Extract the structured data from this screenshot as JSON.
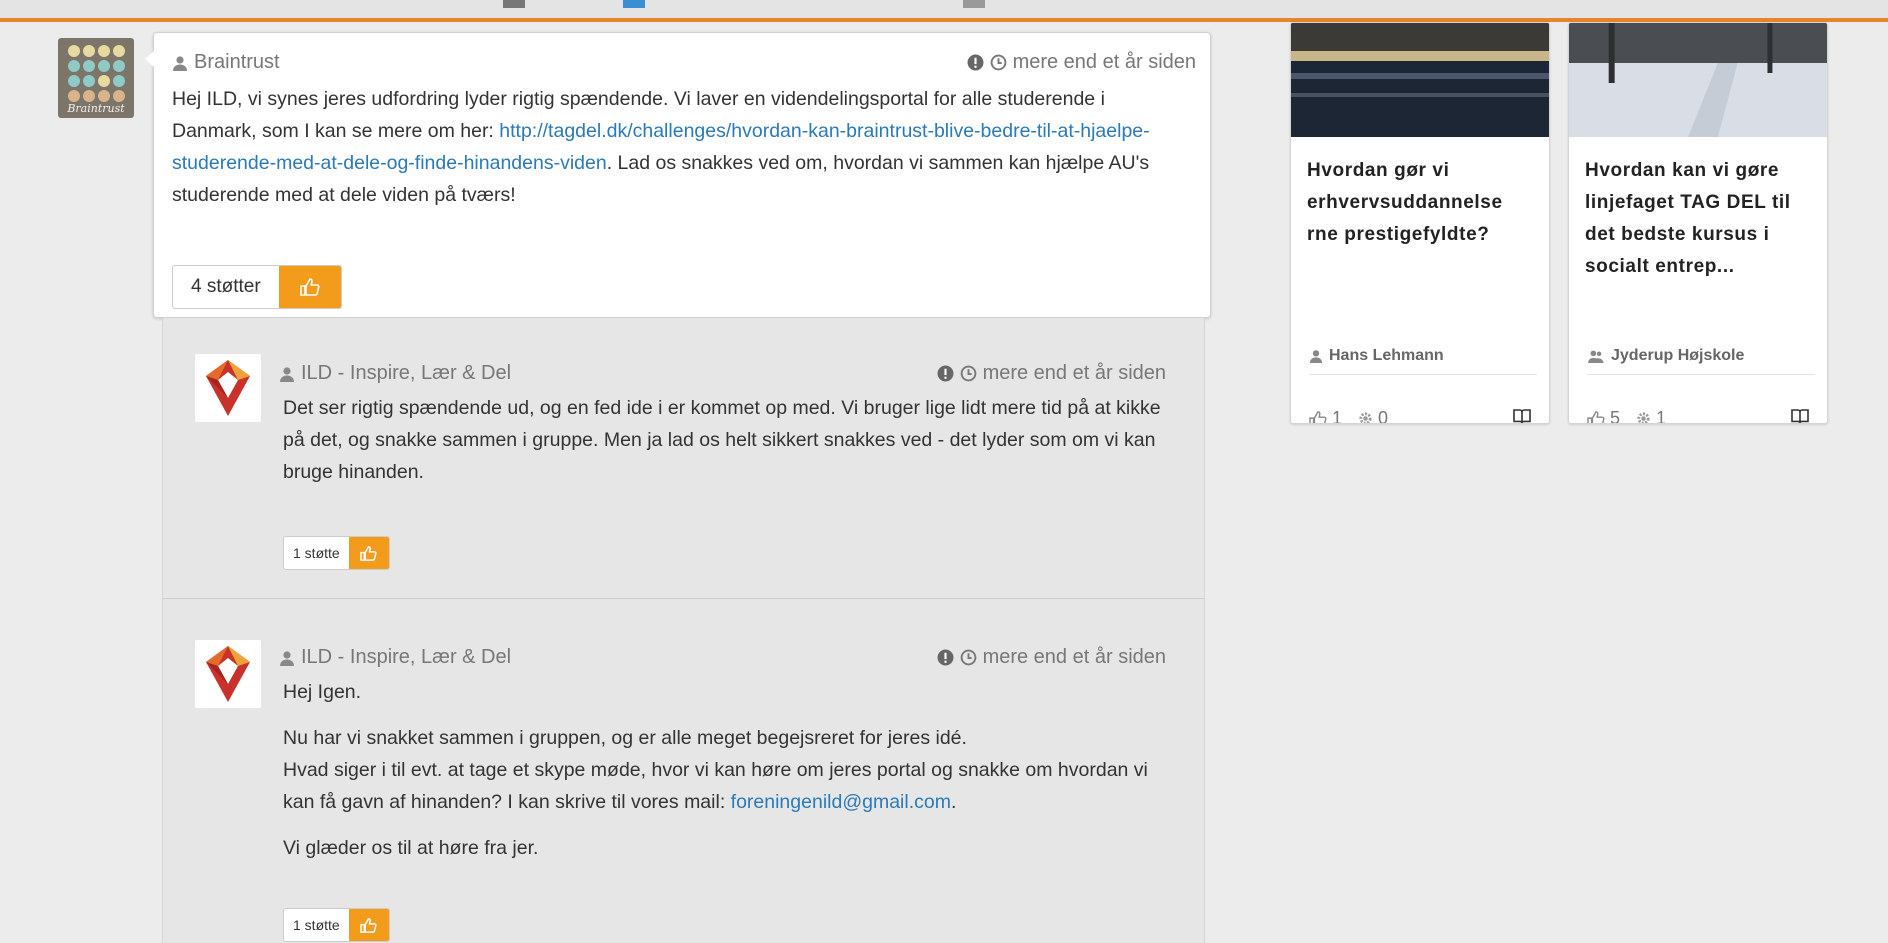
{
  "main_comment": {
    "author": "Braintrust",
    "avatar_text": "Braintrust",
    "time": "mere end et år siden",
    "text_before_link": "Hej ILD, vi synes jeres udfordring lyder rigtig spændende. Vi laver en videndelingsportal for alle studerende i Danmark, som I kan se mere om her: ",
    "link": "http://tagdel.dk/challenges/hvordan-kan-braintrust-blive-bedre-til-at-hjaelpe-studerende-med-at-dele-og-finde-hinandens-viden",
    "text_after_link": ". Lad os snakkes ved om, hvordan vi sammen kan hjælpe AU's studerende med at dele viden på tværs!",
    "support_label": "4 støtter"
  },
  "replies": [
    {
      "author": "ILD - Inspire, Lær & Del",
      "time": "mere end et år siden",
      "text": "Det ser rigtig spændende ud, og en fed ide i er kommet op med. Vi bruger lige lidt mere tid på at kikke på det, og snakke sammen i gruppe. Men ja lad os helt sikkert snakkes ved - det lyder som om vi kan bruge hinanden.",
      "support_label": "1 støtte"
    },
    {
      "author": "ILD - Inspire, Lær & Del",
      "time": "mere end et år siden",
      "greeting": "Hej Igen.",
      "line1": "Nu har vi snakket sammen i gruppen, og er alle meget begejsreret for jeres idé.",
      "line2_before_email": "Hvad siger i til evt. at tage et skype møde, hvor vi kan høre om jeres portal og snakke om hvordan vi kan få gavn af hinanden? I kan skrive til vores mail: ",
      "email": "foreningenild@gmail.com",
      "line2_after_email": ".",
      "closing": "Vi glæder os til at høre fra jer.",
      "support_label": "1 støtte"
    }
  ],
  "side_cards": [
    {
      "title": "Hvordan gør vi erhvervsuddannelse rne prestigefyldte?",
      "author": "Hans Lehmann",
      "likes": "1",
      "comments": "0"
    },
    {
      "title": "Hvordan kan vi gøre linjefaget TAG DEL til det bedste kursus i socialt entrep...",
      "author": "Jyderup Højskole",
      "likes": "5",
      "comments": "1"
    }
  ],
  "colors": {
    "accent_orange": "#f39b1b",
    "link_blue": "#2a7ab8",
    "topbar_orange": "#e8842c"
  }
}
